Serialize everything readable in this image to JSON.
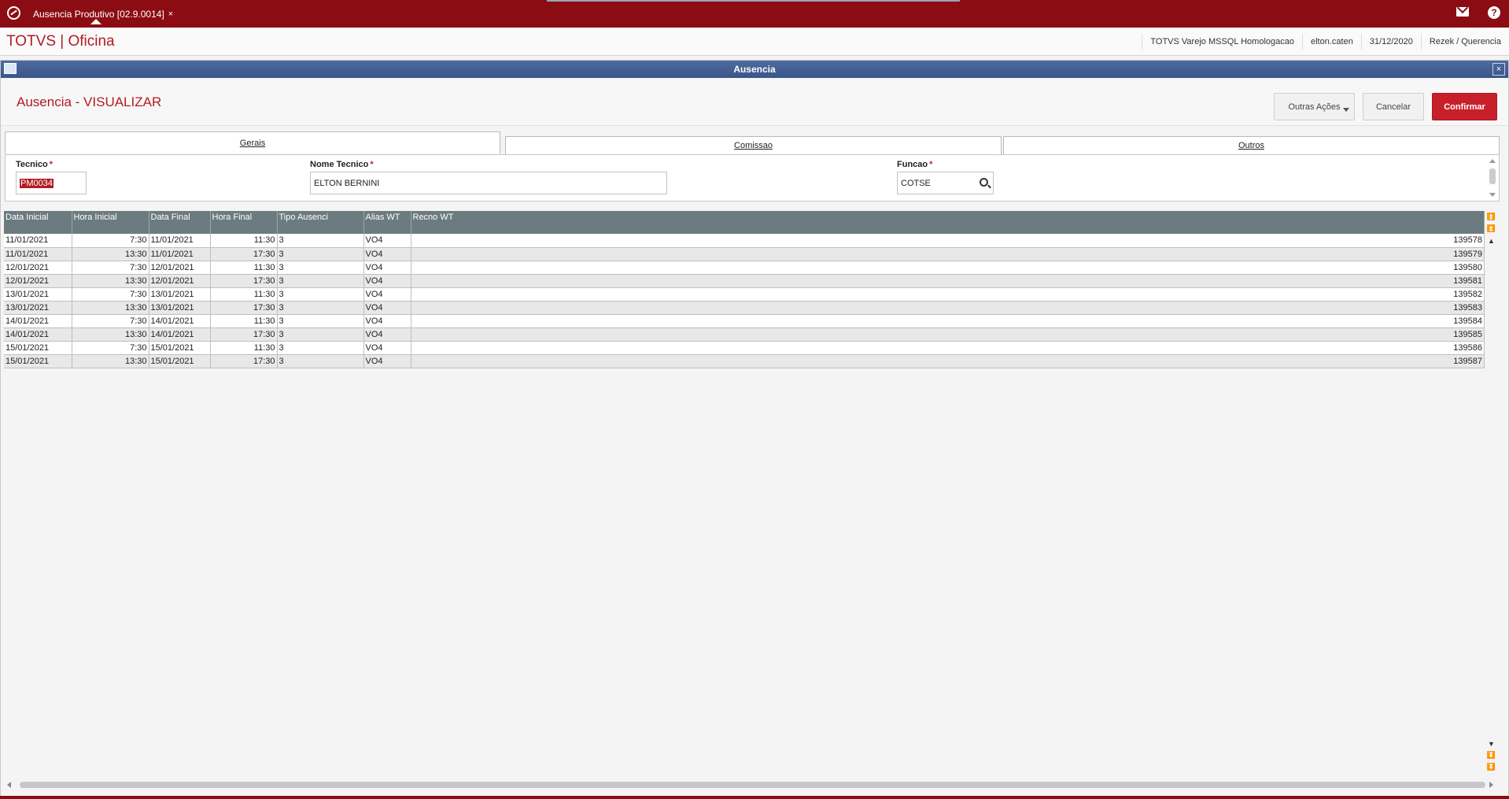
{
  "topbar": {
    "tab_label": "Ausencia Produtivo [02.9.0014]",
    "tab_close": "×",
    "help": "?"
  },
  "header": {
    "brand": "TOTVS | Oficina",
    "environment": "TOTVS Varejo MSSQL Homologacao",
    "user": "elton.caten",
    "date": "31/12/2020",
    "branch": "Rezek / Querencia"
  },
  "dialog": {
    "title": "Ausencia",
    "close": "×",
    "page_title": "Ausencia - VISUALIZAR",
    "buttons": {
      "more": "Outras Ações",
      "cancel": "Cancelar",
      "confirm": "Confirmar"
    },
    "tabs": [
      "Gerais",
      "Comissao",
      "Outros"
    ],
    "form": {
      "tecnico_label": "Tecnico",
      "tecnico_value": "PM0034",
      "nome_label": "Nome Tecnico",
      "nome_value": "ELTON BERNINI",
      "funcao_label": "Funcao",
      "funcao_value": "COTSE",
      "required_mark": "*"
    }
  },
  "grid": {
    "columns": [
      "Data Inicial",
      "Hora Inicial",
      "Data Final",
      "Hora Final",
      "Tipo Ausenci",
      "Alias WT",
      "Recno WT"
    ],
    "rows": [
      [
        "11/01/2021",
        "7:30",
        "11/01/2021",
        "11:30",
        "3",
        "VO4",
        "139578"
      ],
      [
        "11/01/2021",
        "13:30",
        "11/01/2021",
        "17:30",
        "3",
        "VO4",
        "139579"
      ],
      [
        "12/01/2021",
        "7:30",
        "12/01/2021",
        "11:30",
        "3",
        "VO4",
        "139580"
      ],
      [
        "12/01/2021",
        "13:30",
        "12/01/2021",
        "17:30",
        "3",
        "VO4",
        "139581"
      ],
      [
        "13/01/2021",
        "7:30",
        "13/01/2021",
        "11:30",
        "3",
        "VO4",
        "139582"
      ],
      [
        "13/01/2021",
        "13:30",
        "13/01/2021",
        "17:30",
        "3",
        "VO4",
        "139583"
      ],
      [
        "14/01/2021",
        "7:30",
        "14/01/2021",
        "11:30",
        "3",
        "VO4",
        "139584"
      ],
      [
        "14/01/2021",
        "13:30",
        "14/01/2021",
        "17:30",
        "3",
        "VO4",
        "139585"
      ],
      [
        "15/01/2021",
        "7:30",
        "15/01/2021",
        "11:30",
        "3",
        "VO4",
        "139586"
      ],
      [
        "15/01/2021",
        "13:30",
        "15/01/2021",
        "17:30",
        "3",
        "VO4",
        "139587"
      ]
    ]
  }
}
